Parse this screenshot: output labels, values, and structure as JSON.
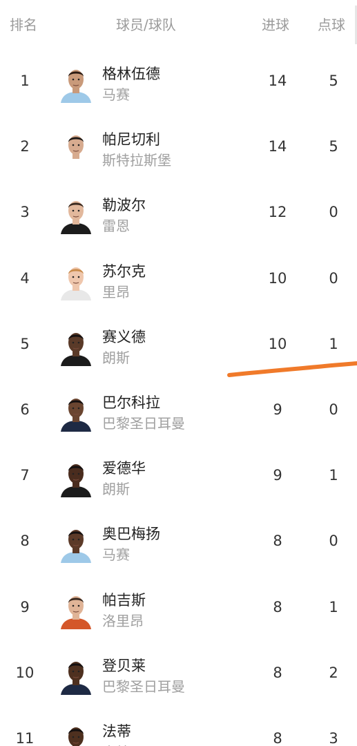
{
  "header": {
    "rank_label": "排名",
    "player_label": "球员/球队",
    "goals_label": "进球",
    "penalties_label": "点球"
  },
  "rows": [
    {
      "rank": "1",
      "name": "格林伍德",
      "team": "马赛",
      "goals": "14",
      "penalties": "5",
      "skin": "#c99a7a",
      "hair": "#2a1a12",
      "shirt": "#9ec9e8"
    },
    {
      "rank": "2",
      "name": "帕尼切利",
      "team": "斯特拉斯堡",
      "goals": "14",
      "penalties": "5",
      "skin": "#d7ab8f",
      "hair": "#1f1a16",
      "shirt": "#ffffff"
    },
    {
      "rank": "3",
      "name": "勒波尔",
      "team": "雷恩",
      "goals": "12",
      "penalties": "0",
      "skin": "#e2b89c",
      "hair": "#3a2a20",
      "shirt": "#1c1c1c"
    },
    {
      "rank": "4",
      "name": "苏尔克",
      "team": "里昂",
      "goals": "10",
      "penalties": "0",
      "skin": "#efc7ad",
      "hair": "#c98b4b",
      "shirt": "#e8e8e8"
    },
    {
      "rank": "5",
      "name": "赛义德",
      "team": "朗斯",
      "goals": "10",
      "penalties": "1",
      "skin": "#5a3a28",
      "hair": "#151010",
      "shirt": "#1b1b1b"
    },
    {
      "rank": "6",
      "name": "巴尔科拉",
      "team": "巴黎圣日耳曼",
      "goals": "9",
      "penalties": "0",
      "skin": "#6a4530",
      "hair": "#141010",
      "shirt": "#1e2a44"
    },
    {
      "rank": "7",
      "name": "爱德华",
      "team": "朗斯",
      "goals": "9",
      "penalties": "1",
      "skin": "#4a2c1e",
      "hair": "#141010",
      "shirt": "#1b1b1b"
    },
    {
      "rank": "8",
      "name": "奥巴梅扬",
      "team": "马赛",
      "goals": "8",
      "penalties": "0",
      "skin": "#5c3a28",
      "hair": "#141010",
      "shirt": "#9ec9e8"
    },
    {
      "rank": "9",
      "name": "帕吉斯",
      "team": "洛里昂",
      "goals": "8",
      "penalties": "1",
      "skin": "#e0b497",
      "hair": "#3a2a20",
      "shirt": "#d4572a"
    },
    {
      "rank": "10",
      "name": "登贝莱",
      "team": "巴黎圣日耳曼",
      "goals": "8",
      "penalties": "2",
      "skin": "#4e301f",
      "hair": "#141010",
      "shirt": "#1e2a44"
    },
    {
      "rank": "11",
      "name": "法蒂",
      "team": "南特",
      "goals": "8",
      "penalties": "3",
      "skin": "#4e301f",
      "hair": "#141010",
      "shirt": "#ffe25a"
    }
  ],
  "annotation_color": "#f07a2a"
}
